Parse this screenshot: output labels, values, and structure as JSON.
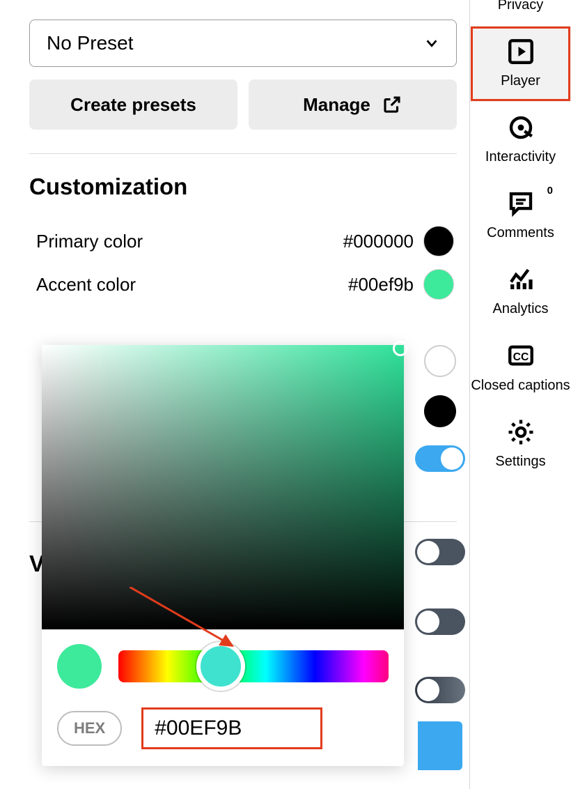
{
  "preset": {
    "selected": "No Preset"
  },
  "buttons": {
    "create": "Create presets",
    "manage": "Manage"
  },
  "section": {
    "title": "Customization",
    "primary_label": "Primary color",
    "primary_value": "#000000",
    "primary_hex": "#000000",
    "accent_label": "Accent color",
    "accent_value": "#00ef9b",
    "accent_hex": "#00ef9b"
  },
  "picker": {
    "hex_chip": "HEX",
    "hex_value": "#00EF9B",
    "preview_hex": "#3de99b"
  },
  "obscured_section_initial": "V",
  "toggles": [
    true,
    false,
    false,
    false
  ],
  "sidebar": {
    "items": [
      {
        "label": "Privacy",
        "icon": "privacy-icon"
      },
      {
        "label": "Player",
        "icon": "player-icon",
        "selected": true
      },
      {
        "label": "Interactivity",
        "icon": "interactivity-icon"
      },
      {
        "label": "Comments",
        "icon": "comments-icon",
        "badge": "0"
      },
      {
        "label": "Analytics",
        "icon": "analytics-icon"
      },
      {
        "label": "Closed captions",
        "icon": "cc-icon"
      },
      {
        "label": "Settings",
        "icon": "settings-icon"
      }
    ]
  }
}
